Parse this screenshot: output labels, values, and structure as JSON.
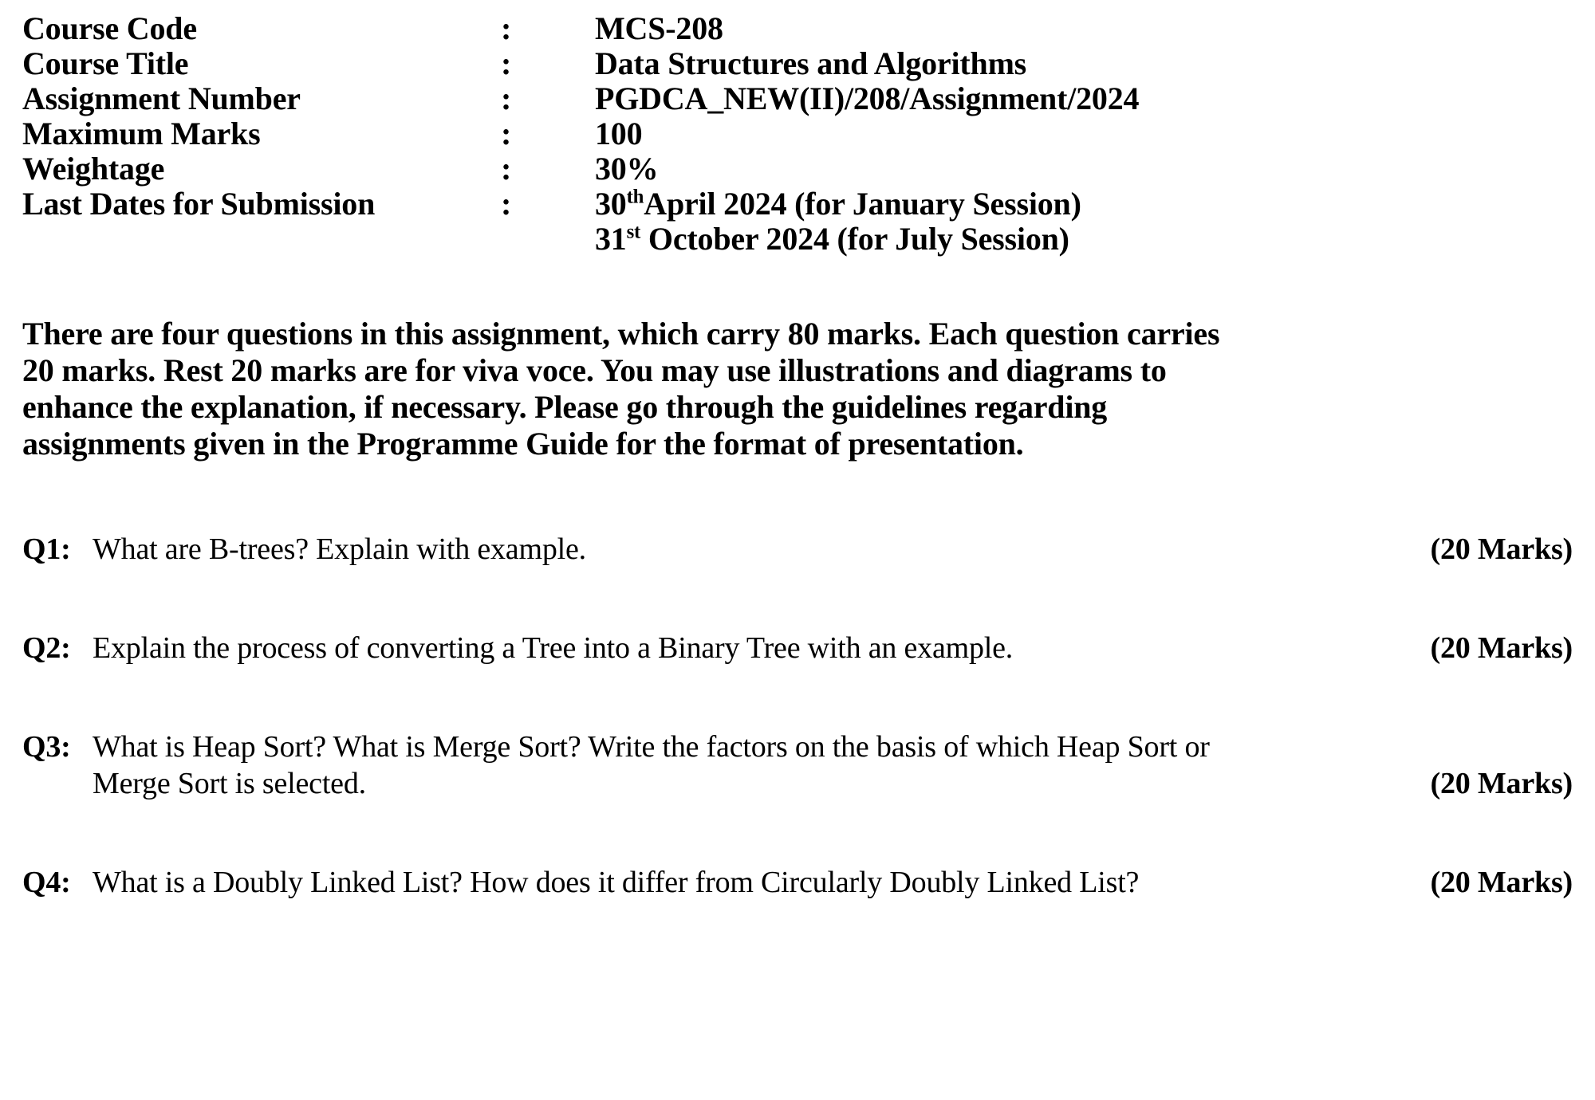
{
  "header": {
    "rows": [
      {
        "label": "Course Code",
        "colon": ":",
        "value": "MCS-208"
      },
      {
        "label": "Course Title",
        "colon": ":",
        "value": "Data Structures and Algorithms"
      },
      {
        "label": "Assignment Number",
        "colon": ":",
        "value": "PGDCA_NEW(II)/208/Assignment/2024"
      },
      {
        "label": "Maximum Marks",
        "colon": ":",
        "value": "100"
      },
      {
        "label": "Weightage",
        "colon": ":",
        "value": "30%"
      },
      {
        "label": "Last Dates for Submission",
        "colon": ":",
        "value": ""
      }
    ],
    "submission_dates": {
      "first": {
        "day": "30",
        "ordinal": "th",
        "rest": "April 2024 (for January Session)"
      },
      "second": {
        "day": "31",
        "ordinal": "st",
        "rest": " October 2024 (for July Session)"
      }
    }
  },
  "intro": {
    "lines": [
      "There are four questions in this assignment, which carry 80 marks. Each question carries",
      "20 marks. Rest 20 marks are for viva voce. You may use illustrations and diagrams to",
      "enhance the explanation, if necessary. Please go through the guidelines regarding",
      "assignments given in the Programme Guide for the format of presentation."
    ],
    "full_text": "There are four questions in this assignment, which carry 80 marks. Each question carries 20 marks. Rest 20 marks are for viva voce. You may use illustrations and diagrams to enhance the explanation, if necessary. Please go through the guidelines regarding assignments given in the Programme Guide for the format of presentation."
  },
  "questions": [
    {
      "number": "Q1:",
      "text_line1": "What are B-trees? Explain with example.",
      "text_line2": "",
      "marks": "(20 Marks)",
      "marks_on_line": 1
    },
    {
      "number": "Q2:",
      "text_line1": "Explain the process of converting a Tree into a Binary Tree with an example.",
      "text_line2": "",
      "marks": "(20 Marks)",
      "marks_on_line": 1
    },
    {
      "number": "Q3:",
      "text_line1": "What is Heap Sort? What is Merge Sort? Write the factors on the basis of which Heap Sort or",
      "text_line2": "Merge Sort is selected.",
      "marks": "(20 Marks)",
      "marks_on_line": 2
    },
    {
      "number": "Q4:",
      "text_line1": "What is a Doubly Linked List? How does it differ from Circularly Doubly Linked List?",
      "text_line2": "",
      "marks": "(20 Marks)",
      "marks_on_line": 1
    }
  ]
}
